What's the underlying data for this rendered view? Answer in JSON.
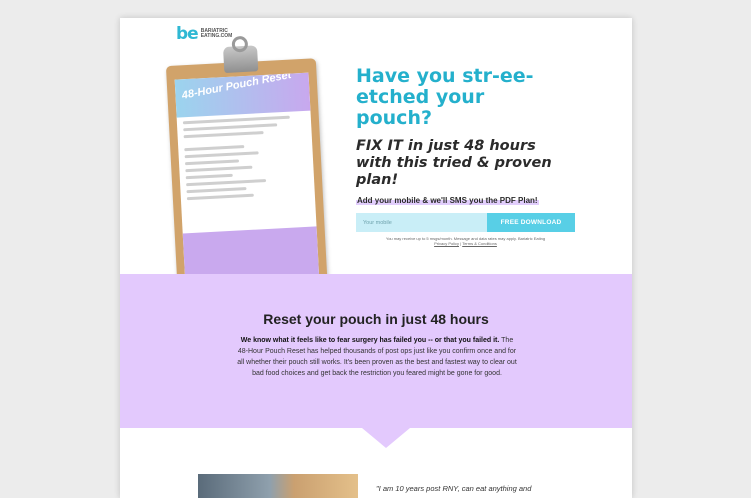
{
  "brand": {
    "mark": "be",
    "name_line1": "BARIATRIC",
    "name_line2": "EATING.COM"
  },
  "clipboard": {
    "title": "48-Hour Pouch Reset"
  },
  "hero": {
    "headline": "Have you str-ee-etched your pouch?",
    "subheadline": "FIX IT in just 48 hours with this tried & proven plan!"
  },
  "form": {
    "prompt": "Add your mobile & we'll SMS you the PDF Plan!",
    "mobile_placeholder": "Your mobile",
    "button_label": "FREE DOWNLOAD",
    "disclaimer": "You may receive up to 5 msgs/month. Message and data rates may apply. Bariatric Eating",
    "privacy_link": "Privacy Policy",
    "separator": " | ",
    "terms_link": "Terms & Conditions"
  },
  "section": {
    "heading": "Reset your pouch in just 48 hours",
    "body_bold": "We know what it feels like to fear surgery has failed you -- or that you failed it.",
    "body": " The 48-Hour Pouch Reset has helped thousands of post ops just like you confirm once and for all whether their pouch still works. It's been proven as the best and fastest way to clear out bad food choices and get back the restriction you feared might be gone for good."
  },
  "testimonial": {
    "text": "\"I am 10 years post RNY, can eat anything and"
  },
  "colors": {
    "accent": "#24b0cc",
    "purple": "#e3c9fd",
    "button": "#58cfe6"
  }
}
